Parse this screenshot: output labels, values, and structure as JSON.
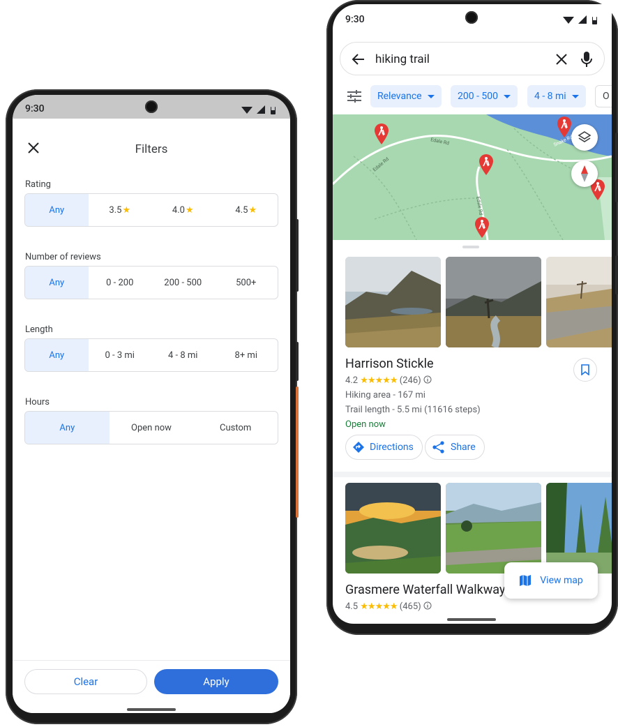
{
  "filters_screen": {
    "status_time": "9:30",
    "title": "Filters",
    "sections": [
      {
        "label": "Rating",
        "options": [
          "Any",
          "3.5",
          "4.0",
          "4.5"
        ],
        "star_options": [
          false,
          true,
          true,
          true
        ],
        "selected": 0
      },
      {
        "label": "Number of reviews",
        "options": [
          "Any",
          "0 - 200",
          "200 - 500",
          "500+"
        ],
        "selected": 0
      },
      {
        "label": "Length",
        "options": [
          "Any",
          "0 - 3 mi",
          "4 - 8 mi",
          "8+ mi"
        ],
        "selected": 0
      },
      {
        "label": "Hours",
        "options": [
          "Any",
          "Open now",
          "Custom"
        ],
        "selected": 0
      }
    ],
    "clear_label": "Clear",
    "apply_label": "Apply",
    "star_glyph": "★"
  },
  "results_screen": {
    "status_time": "9:30",
    "search_query": "hiking trail",
    "chips": [
      "Relevance",
      "200 - 500",
      "4 - 8 mi",
      "O"
    ],
    "results": [
      {
        "name": "Harrison Stickle",
        "rating": "4.2",
        "stars": "★★★★★",
        "reviews": "(246)",
        "type_distance": "Hiking area - 167 mi",
        "trail_length": "Trail length - 5.5 mi (11616 steps)",
        "status": "Open now"
      },
      {
        "name": "Grasmere Waterfall Walkways",
        "rating": "4.5",
        "stars": "★★★★★",
        "reviews": "(465)"
      }
    ],
    "directions_label": "Directions",
    "share_label": "Share",
    "view_map_label": "View map",
    "map_road_labels": [
      "Edale Rd",
      "Edale Rd",
      "Edale Rd",
      "Snake Rd"
    ]
  },
  "colors": {
    "accent": "#1a73e8",
    "apply_button": "#2f6fdc",
    "chip_bg": "#e8f0fe",
    "star": "#fbbc04",
    "open_green": "#188038",
    "pin_red": "#e53935",
    "map_green": "#a8d8b0",
    "water": "#5b8fd8"
  }
}
